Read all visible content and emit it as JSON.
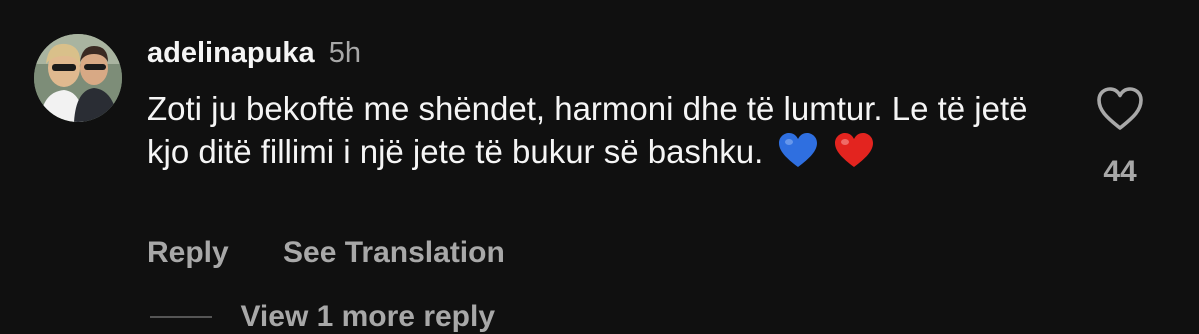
{
  "comment": {
    "username": "adelinapuka",
    "time": "5h",
    "text": "Zoti ju bekoftë me shëndet, harmoni dhe të lumtur. Le të jetë kjo ditë fillimi i një jete të bukur së bashku.",
    "emojis": [
      "blue-heart",
      "red-heart"
    ],
    "reply_label": "Reply",
    "see_translation_label": "See Translation",
    "like_count": "44",
    "like_icon": "heart-outline-icon",
    "view_more_label": "View 1 more reply"
  },
  "colors": {
    "background": "#101010",
    "primary_text": "#f5f5f5",
    "secondary_text": "#a8a8a8",
    "blue_heart": "#2f6fe0",
    "red_heart": "#e3241f"
  }
}
